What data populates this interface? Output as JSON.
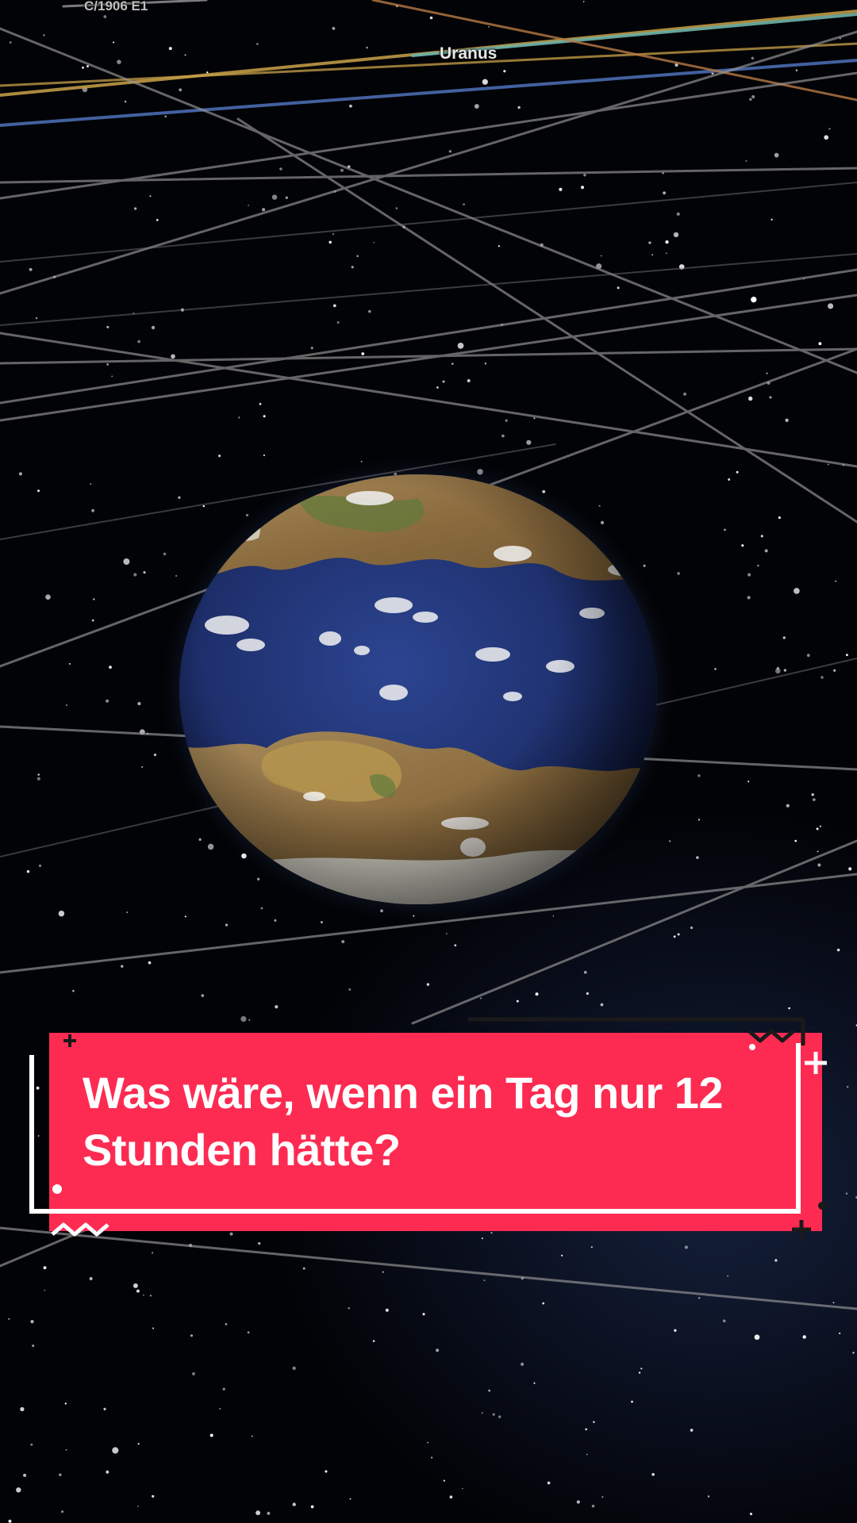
{
  "orbit_labels": {
    "comet": "C/1906 E1",
    "planet": "Uranus"
  },
  "caption": {
    "text": "Was wäre, wenn ein Tag nur 12 Stunden hätte?"
  },
  "colors": {
    "caption_background": "#fd2b52",
    "caption_text": "#ffffff",
    "ocean": "#1f3170",
    "land": "#9c7a4a",
    "orbit_gray": "#9a9a9a",
    "orbit_gold": "#c9a24a",
    "orbit_blue": "#4a6ab0",
    "orbit_teal": "#6fb3a8"
  },
  "icons": {
    "frame_plus": "plus-icon",
    "frame_zigzag": "zigzag-icon",
    "frame_dot": "dot-icon"
  }
}
